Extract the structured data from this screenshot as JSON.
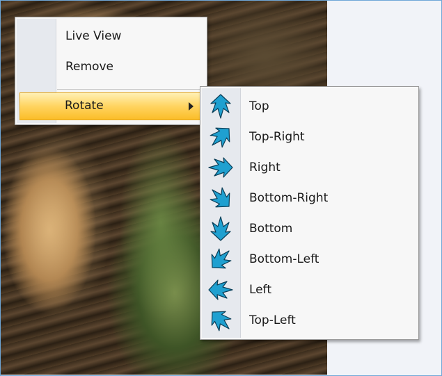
{
  "context_menu": {
    "items": [
      {
        "label": "Live View"
      },
      {
        "label": "Remove"
      },
      {
        "label": "Rotate",
        "has_submenu": true,
        "highlighted": true
      }
    ]
  },
  "rotate_submenu": {
    "items": [
      {
        "label": "Top",
        "icon": "rotate-top-icon"
      },
      {
        "label": "Top-Right",
        "icon": "rotate-top-right-icon"
      },
      {
        "label": "Right",
        "icon": "rotate-right-icon"
      },
      {
        "label": "Bottom-Right",
        "icon": "rotate-bottom-right-icon"
      },
      {
        "label": "Bottom",
        "icon": "rotate-bottom-icon"
      },
      {
        "label": "Bottom-Left",
        "icon": "rotate-bottom-left-icon"
      },
      {
        "label": "Left",
        "icon": "rotate-left-icon"
      },
      {
        "label": "Top-Left",
        "icon": "rotate-top-left-icon"
      }
    ]
  },
  "colors": {
    "highlight": "#ffd460",
    "icon_fill": "#1fa0d0",
    "menu_bg": "#f7f7f7",
    "gutter": "#e6e9ee"
  }
}
